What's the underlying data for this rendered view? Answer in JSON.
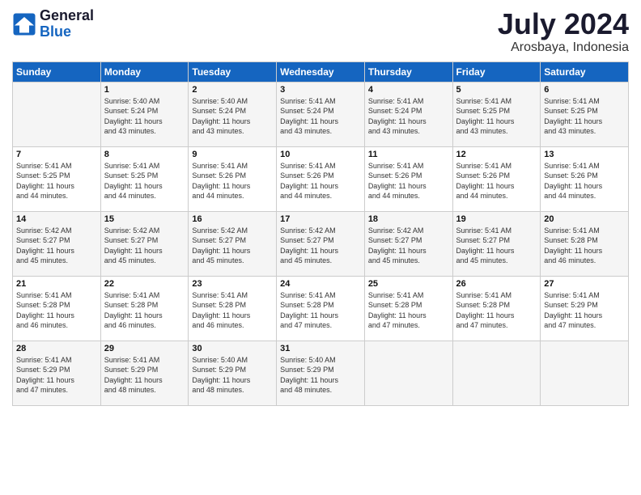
{
  "header": {
    "logo_line1": "General",
    "logo_line2": "Blue",
    "month_title": "July 2024",
    "location": "Arosbaya, Indonesia"
  },
  "days_of_week": [
    "Sunday",
    "Monday",
    "Tuesday",
    "Wednesday",
    "Thursday",
    "Friday",
    "Saturday"
  ],
  "weeks": [
    [
      {
        "day": "",
        "info": ""
      },
      {
        "day": "1",
        "info": "Sunrise: 5:40 AM\nSunset: 5:24 PM\nDaylight: 11 hours\nand 43 minutes."
      },
      {
        "day": "2",
        "info": "Sunrise: 5:40 AM\nSunset: 5:24 PM\nDaylight: 11 hours\nand 43 minutes."
      },
      {
        "day": "3",
        "info": "Sunrise: 5:41 AM\nSunset: 5:24 PM\nDaylight: 11 hours\nand 43 minutes."
      },
      {
        "day": "4",
        "info": "Sunrise: 5:41 AM\nSunset: 5:24 PM\nDaylight: 11 hours\nand 43 minutes."
      },
      {
        "day": "5",
        "info": "Sunrise: 5:41 AM\nSunset: 5:25 PM\nDaylight: 11 hours\nand 43 minutes."
      },
      {
        "day": "6",
        "info": "Sunrise: 5:41 AM\nSunset: 5:25 PM\nDaylight: 11 hours\nand 43 minutes."
      }
    ],
    [
      {
        "day": "7",
        "info": "Sunrise: 5:41 AM\nSunset: 5:25 PM\nDaylight: 11 hours\nand 44 minutes."
      },
      {
        "day": "8",
        "info": "Sunrise: 5:41 AM\nSunset: 5:25 PM\nDaylight: 11 hours\nand 44 minutes."
      },
      {
        "day": "9",
        "info": "Sunrise: 5:41 AM\nSunset: 5:26 PM\nDaylight: 11 hours\nand 44 minutes."
      },
      {
        "day": "10",
        "info": "Sunrise: 5:41 AM\nSunset: 5:26 PM\nDaylight: 11 hours\nand 44 minutes."
      },
      {
        "day": "11",
        "info": "Sunrise: 5:41 AM\nSunset: 5:26 PM\nDaylight: 11 hours\nand 44 minutes."
      },
      {
        "day": "12",
        "info": "Sunrise: 5:41 AM\nSunset: 5:26 PM\nDaylight: 11 hours\nand 44 minutes."
      },
      {
        "day": "13",
        "info": "Sunrise: 5:41 AM\nSunset: 5:26 PM\nDaylight: 11 hours\nand 44 minutes."
      }
    ],
    [
      {
        "day": "14",
        "info": "Sunrise: 5:42 AM\nSunset: 5:27 PM\nDaylight: 11 hours\nand 45 minutes."
      },
      {
        "day": "15",
        "info": "Sunrise: 5:42 AM\nSunset: 5:27 PM\nDaylight: 11 hours\nand 45 minutes."
      },
      {
        "day": "16",
        "info": "Sunrise: 5:42 AM\nSunset: 5:27 PM\nDaylight: 11 hours\nand 45 minutes."
      },
      {
        "day": "17",
        "info": "Sunrise: 5:42 AM\nSunset: 5:27 PM\nDaylight: 11 hours\nand 45 minutes."
      },
      {
        "day": "18",
        "info": "Sunrise: 5:42 AM\nSunset: 5:27 PM\nDaylight: 11 hours\nand 45 minutes."
      },
      {
        "day": "19",
        "info": "Sunrise: 5:41 AM\nSunset: 5:27 PM\nDaylight: 11 hours\nand 45 minutes."
      },
      {
        "day": "20",
        "info": "Sunrise: 5:41 AM\nSunset: 5:28 PM\nDaylight: 11 hours\nand 46 minutes."
      }
    ],
    [
      {
        "day": "21",
        "info": "Sunrise: 5:41 AM\nSunset: 5:28 PM\nDaylight: 11 hours\nand 46 minutes."
      },
      {
        "day": "22",
        "info": "Sunrise: 5:41 AM\nSunset: 5:28 PM\nDaylight: 11 hours\nand 46 minutes."
      },
      {
        "day": "23",
        "info": "Sunrise: 5:41 AM\nSunset: 5:28 PM\nDaylight: 11 hours\nand 46 minutes."
      },
      {
        "day": "24",
        "info": "Sunrise: 5:41 AM\nSunset: 5:28 PM\nDaylight: 11 hours\nand 47 minutes."
      },
      {
        "day": "25",
        "info": "Sunrise: 5:41 AM\nSunset: 5:28 PM\nDaylight: 11 hours\nand 47 minutes."
      },
      {
        "day": "26",
        "info": "Sunrise: 5:41 AM\nSunset: 5:28 PM\nDaylight: 11 hours\nand 47 minutes."
      },
      {
        "day": "27",
        "info": "Sunrise: 5:41 AM\nSunset: 5:29 PM\nDaylight: 11 hours\nand 47 minutes."
      }
    ],
    [
      {
        "day": "28",
        "info": "Sunrise: 5:41 AM\nSunset: 5:29 PM\nDaylight: 11 hours\nand 47 minutes."
      },
      {
        "day": "29",
        "info": "Sunrise: 5:41 AM\nSunset: 5:29 PM\nDaylight: 11 hours\nand 48 minutes."
      },
      {
        "day": "30",
        "info": "Sunrise: 5:40 AM\nSunset: 5:29 PM\nDaylight: 11 hours\nand 48 minutes."
      },
      {
        "day": "31",
        "info": "Sunrise: 5:40 AM\nSunset: 5:29 PM\nDaylight: 11 hours\nand 48 minutes."
      },
      {
        "day": "",
        "info": ""
      },
      {
        "day": "",
        "info": ""
      },
      {
        "day": "",
        "info": ""
      }
    ]
  ]
}
